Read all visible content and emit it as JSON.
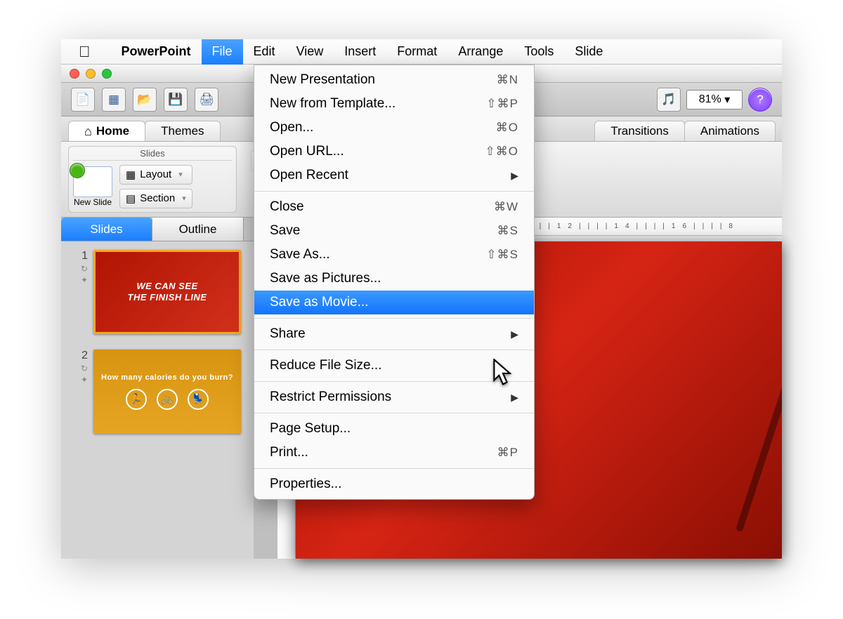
{
  "menubar": {
    "app": "PowerPoint",
    "items": [
      "File",
      "Edit",
      "View",
      "Insert",
      "Format",
      "Arrange",
      "Tools",
      "Slide"
    ],
    "open_index": 0
  },
  "toolbar": {
    "zoom": "81%"
  },
  "ribbon_tabs": [
    "Home",
    "Themes",
    "Transitions",
    "Animations"
  ],
  "ribbon": {
    "slides_group_label": "Slides",
    "new_slide": "New Slide",
    "layout": "Layout",
    "section": "Section"
  },
  "view_tabs": {
    "slides": "Slides",
    "outline": "Outline",
    "selected": "slides"
  },
  "thumbs": [
    {
      "num": "1",
      "title": "WE CAN SEE",
      "title2": "THE FINISH LINE"
    },
    {
      "num": "2",
      "title": "How many calories do you burn?"
    }
  ],
  "file_menu": [
    {
      "label": "New Presentation",
      "shortcut": "⌘N"
    },
    {
      "label": "New from Template...",
      "shortcut": "⇧⌘P"
    },
    {
      "label": "Open...",
      "shortcut": "⌘O"
    },
    {
      "label": "Open URL...",
      "shortcut": "⇧⌘O"
    },
    {
      "label": "Open Recent",
      "submenu": true
    },
    {
      "sep": true
    },
    {
      "label": "Close",
      "shortcut": "⌘W"
    },
    {
      "label": "Save",
      "shortcut": "⌘S"
    },
    {
      "label": "Save As...",
      "shortcut": "⇧⌘S"
    },
    {
      "label": "Save as Pictures..."
    },
    {
      "label": "Save as Movie...",
      "highlight": true
    },
    {
      "sep": true
    },
    {
      "label": "Share",
      "submenu": true
    },
    {
      "sep": true
    },
    {
      "label": "Reduce File Size..."
    },
    {
      "sep": true
    },
    {
      "label": "Restrict Permissions",
      "submenu": true
    },
    {
      "sep": true
    },
    {
      "label": "Page Setup..."
    },
    {
      "label": "Print...",
      "shortcut": "⌘P"
    },
    {
      "sep": true
    },
    {
      "label": "Properties..."
    }
  ]
}
